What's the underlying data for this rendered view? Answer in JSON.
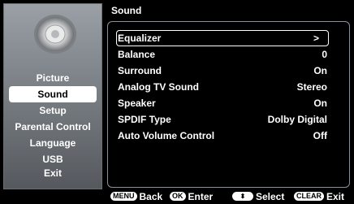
{
  "left_menu": {
    "items": [
      {
        "label": "Picture"
      },
      {
        "label": "Sound",
        "selected": true
      },
      {
        "label": "Setup"
      },
      {
        "label": "Parental Control"
      },
      {
        "label": "Language"
      },
      {
        "label": "USB"
      },
      {
        "label": "Exit"
      }
    ]
  },
  "header": {
    "title": "Sound"
  },
  "settings": [
    {
      "label": "Equalizer",
      "value": ">",
      "selected": true
    },
    {
      "label": "Balance",
      "value": "0"
    },
    {
      "label": "Surround",
      "value": "On"
    },
    {
      "label": "Analog TV Sound",
      "value": "Stereo"
    },
    {
      "label": "Speaker",
      "value": "On"
    },
    {
      "label": "SPDIF Type",
      "value": "Dolby Digital"
    },
    {
      "label": "Auto Volume Control",
      "value": "Off"
    }
  ],
  "footer": {
    "back_key": "MENU",
    "back_label": "Back",
    "enter_key": "OK",
    "enter_label": "Enter",
    "select_key": "⬍",
    "select_label": "Select",
    "exit_key": "CLEAR",
    "exit_label": "Exit"
  },
  "icons": {
    "header_icon": "speaker-icon"
  },
  "colors": {
    "panel_border": "#8b9096",
    "sidebar_top": "#9aa0a6",
    "sidebar_bottom": "#55595e"
  }
}
